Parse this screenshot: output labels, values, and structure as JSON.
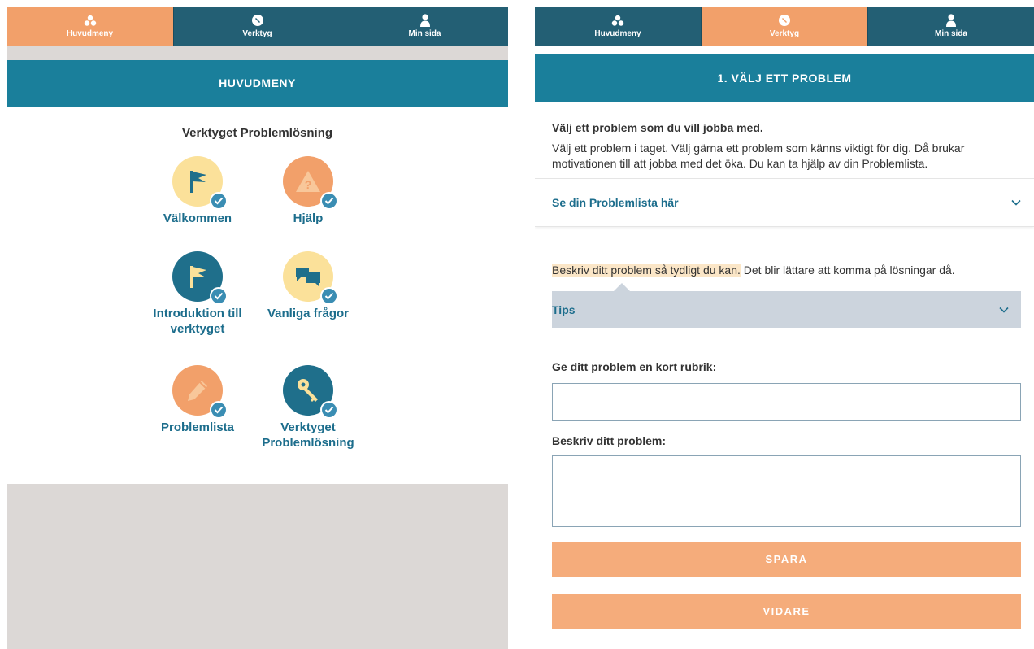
{
  "tabs": [
    {
      "label": "Huvudmeny",
      "icon": "three-circles-icon"
    },
    {
      "label": "Verktyg",
      "icon": "tool-icon"
    },
    {
      "label": "Min sida",
      "icon": "person-icon"
    }
  ],
  "left": {
    "active_tab": "Huvudmeny",
    "header": "HUVUDMENY",
    "title": "Verktyget Problemlösning",
    "items": [
      {
        "label": "Välkommen",
        "icon": "flag-icon",
        "color": "#fbe19a",
        "done": true
      },
      {
        "label": "Hjälp",
        "icon": "warning-icon",
        "color": "#f2a06a",
        "done": true
      },
      {
        "label": "Introduktion till verktyget",
        "icon": "flag-icon",
        "color": "#1f6f8b",
        "done": true
      },
      {
        "label": "Vanliga frågor",
        "icon": "chat-bubbles-icon",
        "color": "#fbe19a",
        "done": true
      },
      {
        "label": "Problemlista",
        "icon": "pencil-icon",
        "color": "#f2a06a",
        "done": true
      },
      {
        "label": "Verktyget Problemlösning",
        "icon": "key-icon",
        "color": "#1f6f8b",
        "done": true
      }
    ]
  },
  "right": {
    "active_tab": "Verktyg",
    "header": "1. VÄLJ ETT PROBLEM",
    "intro_title": "Välj ett problem som du vill jobba med.",
    "intro_text": "Välj ett problem i taget. Välj gärna ett problem som känns viktigt för dig. Då brukar motivationen till att jobba med det öka. Du kan ta hjälp av din Problemlista.",
    "expander_label": "Se din Problemlista här",
    "describe_highlight": "Beskriv ditt problem så tydligt du kan.",
    "describe_rest": " Det blir lättare att komma på lösningar då.",
    "tips_label": "Tips",
    "heading_label": "Ge ditt problem en kort rubrik:",
    "heading_value": "",
    "problem_label": "Beskriv ditt problem:",
    "problem_value": "",
    "save_button": "SPARA",
    "next_button": "VIDARE"
  },
  "colors": {
    "tabbar": "#235f74",
    "active_tab": "#f2a06a",
    "header": "#1a7f9b",
    "link": "#1c6d8c",
    "button": "#f5ac7b",
    "check": "#3a8db3"
  }
}
